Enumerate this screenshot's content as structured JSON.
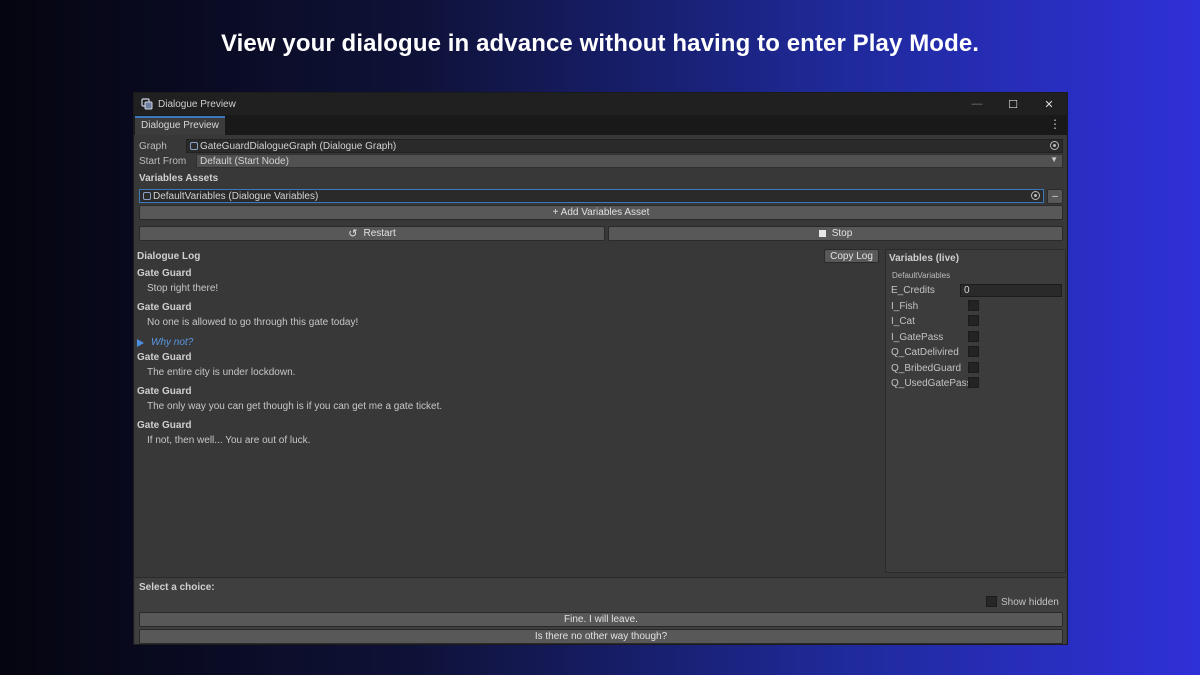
{
  "headline": "View your dialogue in advance without having to enter Play Mode.",
  "window": {
    "title": "Dialogue Preview",
    "tab_label": "Dialogue Preview",
    "controls": {
      "minimize": "—",
      "maximize": "☐",
      "close": "✕"
    }
  },
  "form": {
    "graph_label": "Graph",
    "graph_value": "GateGuardDialogueGraph (Dialogue Graph)",
    "start_from_label": "Start From",
    "start_from_value": "Default (Start Node)",
    "variables_assets_title": "Variables Assets",
    "variables_asset_value": "DefaultVariables (Dialogue Variables)",
    "remove_button": "–",
    "add_variables_asset": "+ Add Variables Asset",
    "restart_label": "Restart",
    "stop_label": "Stop"
  },
  "log": {
    "title": "Dialogue Log",
    "copy_button": "Copy Log",
    "entries": [
      {
        "speaker": "Gate Guard",
        "text": "Stop right there!"
      },
      {
        "speaker": "Gate Guard",
        "text": "No one is allowed to go through this gate today!"
      },
      {
        "choice": "Why not?"
      },
      {
        "speaker": "Gate Guard",
        "text": "The entire city is under lockdown."
      },
      {
        "speaker": "Gate Guard",
        "text": "The only way you can get though is if you can get me a gate ticket."
      },
      {
        "speaker": "Gate Guard",
        "text": "If not, then well... You are out of luck."
      }
    ]
  },
  "variables": {
    "title": "Variables  (live)",
    "asset_name": "DefaultVariables",
    "items": [
      {
        "name": "E_Credits",
        "value": "0"
      },
      {
        "name": "I_Fish"
      },
      {
        "name": "I_Cat"
      },
      {
        "name": "I_GatePass"
      },
      {
        "name": "Q_CatDelivired"
      },
      {
        "name": "Q_BribedGuard"
      },
      {
        "name": "Q_UsedGatePass"
      }
    ]
  },
  "choices": {
    "title": "Select a choice:",
    "show_hidden_label": "Show hidden",
    "options": [
      "Fine. I will leave.",
      "Is there no other way though?"
    ]
  },
  "colors": {
    "accent": "#3a79bb",
    "choice_text": "#5a98e3",
    "panel_bg": "#383838"
  }
}
